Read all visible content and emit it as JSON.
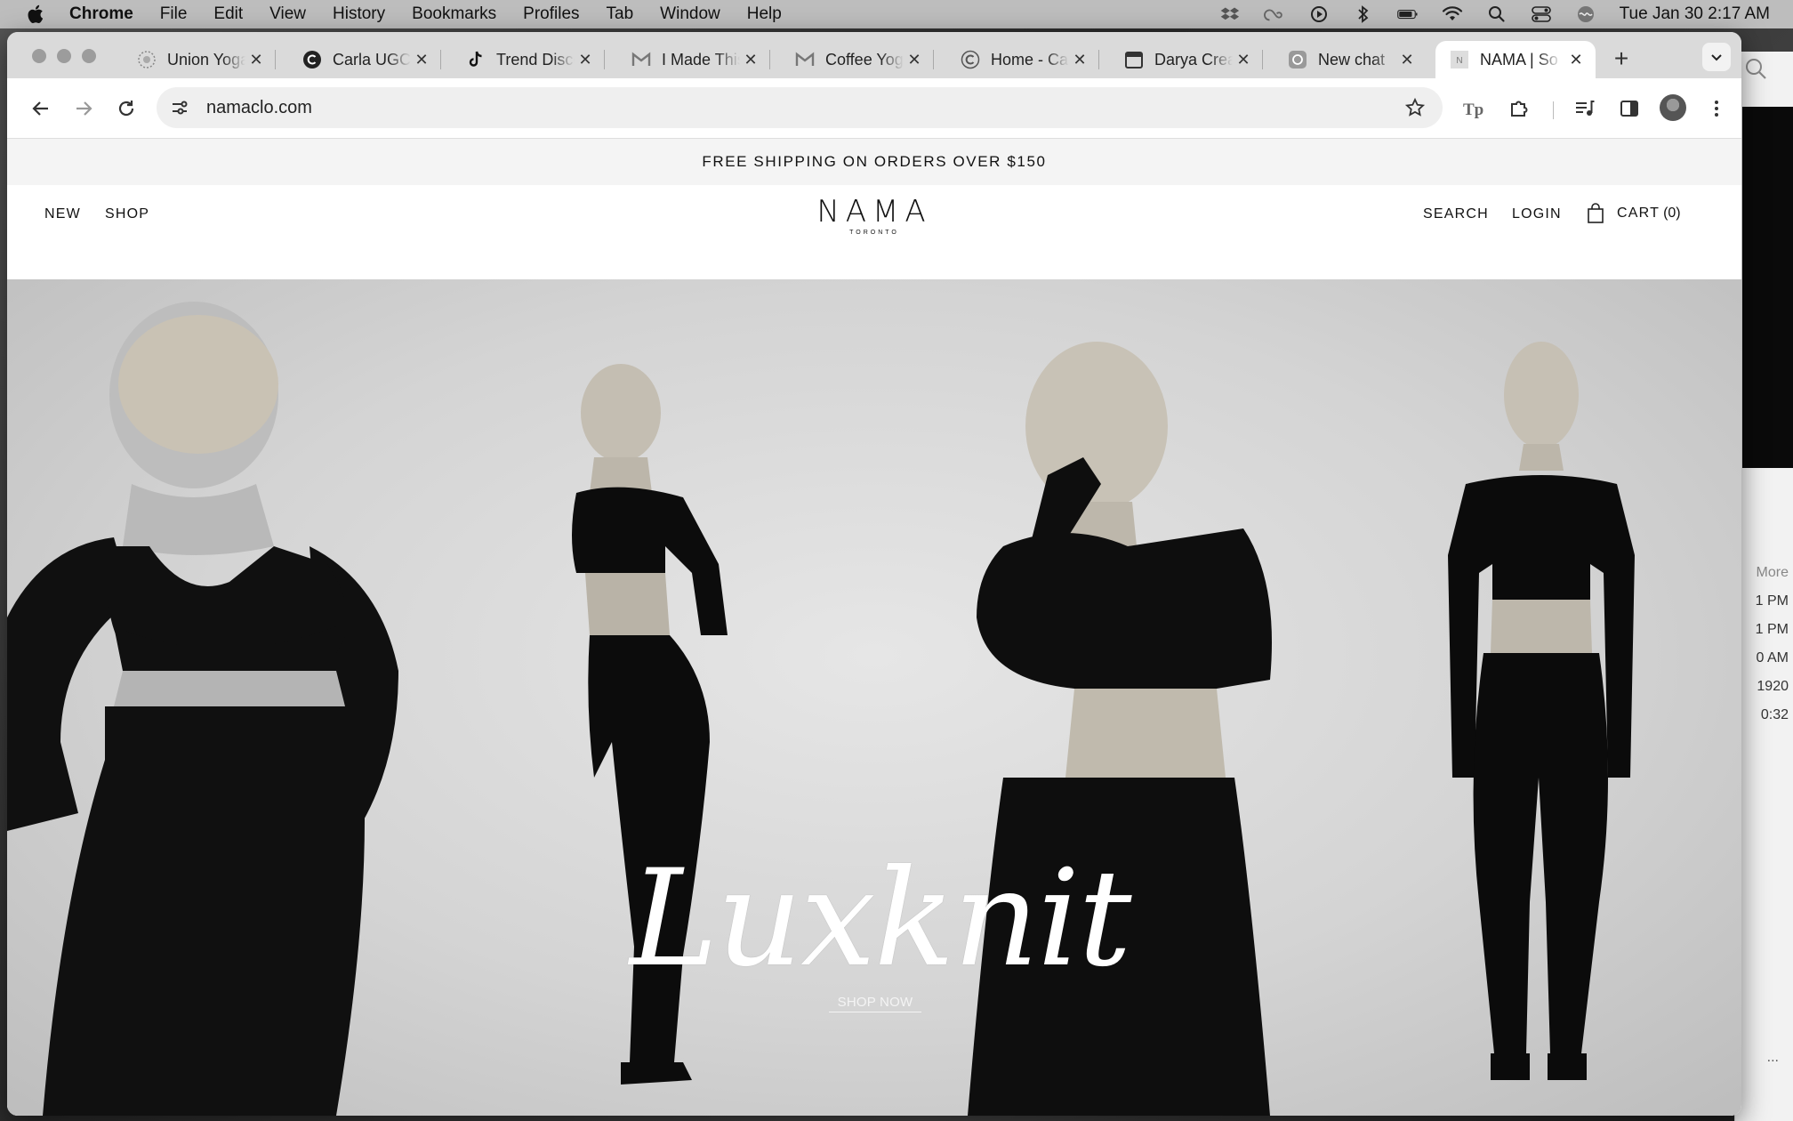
{
  "menubar": {
    "app_name": "Chrome",
    "items": [
      "File",
      "Edit",
      "View",
      "History",
      "Bookmarks",
      "Profiles",
      "Tab",
      "Window",
      "Help"
    ],
    "clock": "Tue Jan 30  2:17 AM",
    "status_icons": [
      "dropbox-icon",
      "creative-cloud-icon",
      "play-icon",
      "bluetooth-icon",
      "battery-icon",
      "wifi-icon",
      "spotlight-icon",
      "control-center-icon",
      "siri-icon"
    ]
  },
  "tabs": [
    {
      "title": "Union Yoga",
      "icon": "union-yoga-favicon",
      "active": false
    },
    {
      "title": "Carla UGC",
      "icon": "c-circle-favicon",
      "active": false
    },
    {
      "title": "Trend Discovery",
      "icon": "tiktok-favicon",
      "active": false
    },
    {
      "title": "I Made This",
      "icon": "gmail-favicon",
      "active": false
    },
    {
      "title": "Coffee Yoga",
      "icon": "gmail-favicon",
      "active": false
    },
    {
      "title": "Home - Ca",
      "icon": "c-circle-favicon",
      "active": false
    },
    {
      "title": "Darya Creates",
      "icon": "calendar-favicon",
      "active": false
    },
    {
      "title": "New chat",
      "icon": "chatgpt-favicon",
      "active": false
    },
    {
      "title": "NAMA | So",
      "icon": "nama-favicon",
      "active": true
    }
  ],
  "toolbar": {
    "url": "namaclo.com"
  },
  "site": {
    "announcement": "FREE SHIPPING ON ORDERS OVER $150",
    "nav_left": [
      "NEW",
      "SHOP"
    ],
    "logo": "NAMA",
    "logo_sub": "TORONTO",
    "nav_right": {
      "search": "SEARCH",
      "login": "LOGIN",
      "cart": "CART",
      "cart_count": "(0)"
    },
    "hero": {
      "title": "Luxknit",
      "cta": "SHOP NOW"
    }
  },
  "side_window": {
    "more_label": "More",
    "rows": [
      "1 PM",
      "1 PM",
      "0 AM",
      "1920",
      "0:32"
    ],
    "ellipsis": "..."
  },
  "colors": {
    "menubar": "#bdbdbd",
    "tabstrip": "#dadada",
    "announce_bg": "#f4f4f4",
    "hero_text": "#ffffff"
  }
}
